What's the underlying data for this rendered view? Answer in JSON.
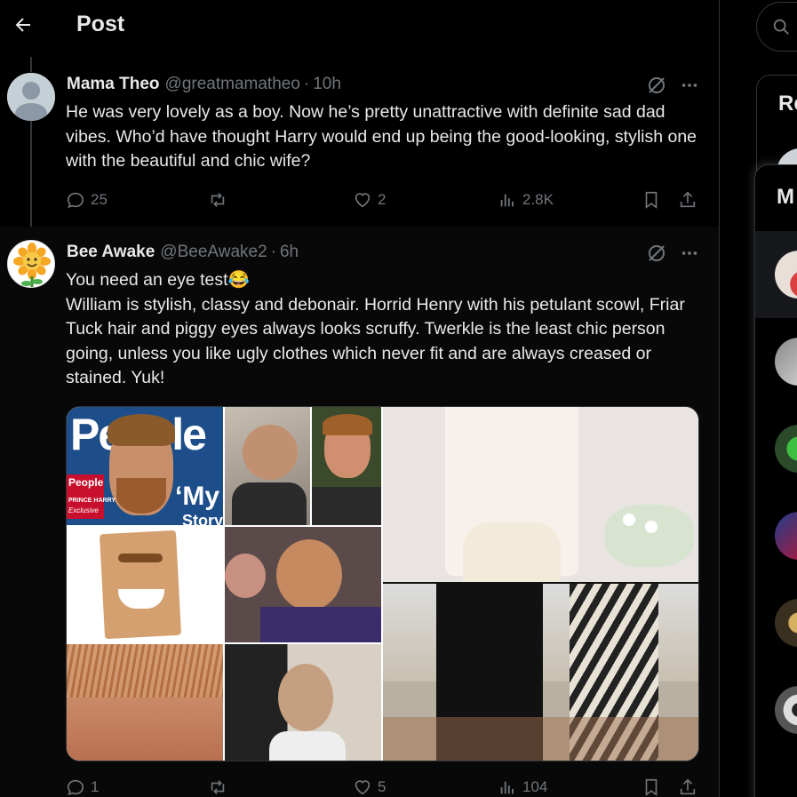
{
  "header": {
    "title": "Post"
  },
  "tweets": [
    {
      "name": "Mama Theo",
      "handle": "@greatmamatheo",
      "time": "10h",
      "text": [
        "He was very lovely as a boy. Now he’s pretty unattractive with definite sad dad vibes. Who’d have thought Harry would end up being the good-looking, stylish one with the beautiful and chic wife?"
      ],
      "replies": "25",
      "reposts": "",
      "likes": "2",
      "views": "2.8K"
    },
    {
      "name": "Bee Awake",
      "handle": "@BeeAwake2",
      "time": "6h",
      "text": [
        "You need an eye test😂",
        "William is stylish, classy and debonair. Horrid Henry with his petulant scowl, Friar Tuck hair and piggy eyes always looks scruffy. Twerkle is the least chic person going, unless you like ugly clothes which never fit and are always creased or stained. Yuk!"
      ],
      "replies": "1",
      "reposts": "",
      "likes": "5",
      "views": "104",
      "media": {
        "magazine_title": "People",
        "magazine_corner": "People",
        "magazine_sub1": "PRINCE HARRY",
        "magazine_sub2": "Exclusive",
        "magazine_quote": "‘My",
        "magazine_quote2": "Story"
      }
    }
  ],
  "sidebar": {
    "relevant_title": "Re",
    "messages_title": "M"
  },
  "icons": {
    "back": "arrow-left-icon",
    "grok": "grok-icon",
    "more": "more-dots-icon",
    "reply": "reply-icon",
    "repost": "repost-icon",
    "like": "heart-icon",
    "views": "views-icon",
    "bookmark": "bookmark-icon",
    "share": "share-icon",
    "search": "search-icon"
  },
  "colors": {
    "background": "#000000",
    "text": "#e7e9ea",
    "muted": "#71767b",
    "border": "#2f3336"
  }
}
